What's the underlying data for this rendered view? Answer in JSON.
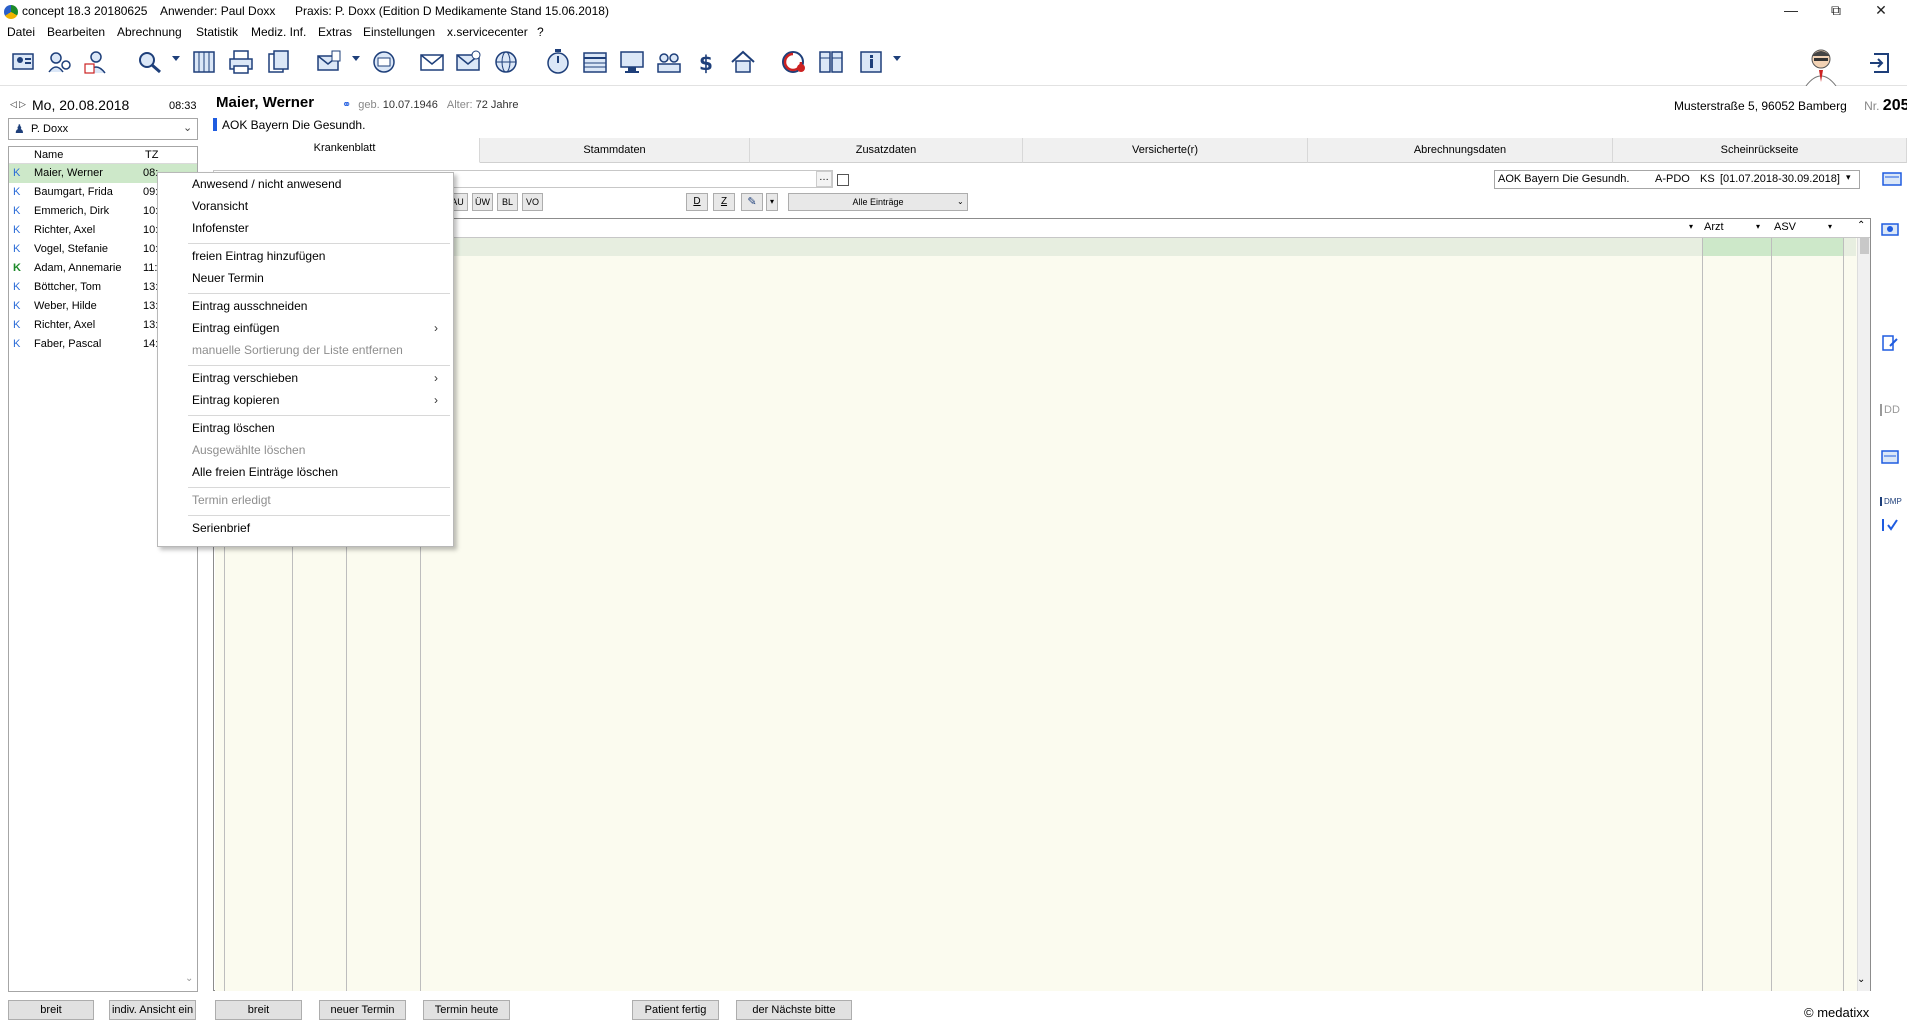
{
  "titlebar": {
    "app": "concept 18.3 20180625",
    "user": "Anwender:  Paul Doxx",
    "practice": "Praxis: P. Doxx  (Edition D Medikamente  Stand 15.06.2018)"
  },
  "menu": [
    "Datei",
    "Bearbeiten",
    "Abrechnung",
    "Statistik",
    "Mediz. Inf.",
    "Extras",
    "Einstellungen",
    "x.servicecenter",
    "?"
  ],
  "left": {
    "date": "Mo, 20.08.2018",
    "time": "08:33",
    "user": "P. Doxx",
    "columns": {
      "name": "Name",
      "tz": "TZ"
    },
    "patients": [
      {
        "k": "K",
        "name": "Maier, Werner",
        "tz": "08:"
      },
      {
        "k": "K",
        "name": "Baumgart, Frida",
        "tz": "09:"
      },
      {
        "k": "K",
        "name": "Emmerich, Dirk",
        "tz": "10:"
      },
      {
        "k": "K",
        "name": "Richter, Axel",
        "tz": "10:"
      },
      {
        "k": "K",
        "name": "Vogel, Stefanie",
        "tz": "10:"
      },
      {
        "k": "K",
        "name": "Adam, Annemarie",
        "tz": "11:"
      },
      {
        "k": "K",
        "name": "Böttcher, Tom",
        "tz": "13:"
      },
      {
        "k": "K",
        "name": "Weber, Hilde",
        "tz": "13:"
      },
      {
        "k": "K",
        "name": "Richter, Axel",
        "tz": "13:"
      },
      {
        "k": "K",
        "name": "Faber, Pascal",
        "tz": "14:"
      }
    ],
    "btn_breit": "breit",
    "btn_indiv": "indiv. Ansicht ein"
  },
  "patient": {
    "name": "Maier, Werner",
    "geb_label": "geb.",
    "geb": "10.07.1946",
    "alter_label": "Alter:",
    "alter": "72 Jahre",
    "address": "Musterstraße 5, 96052 Bamberg",
    "nr_label": "Nr.",
    "nr": "205",
    "insurance": "AOK Bayern Die Gesundh."
  },
  "tabs": [
    "Krankenblatt",
    "Stammdaten",
    "Zusatzdaten",
    "Versicherte(r)",
    "Abrechnungsdaten",
    "Scheinrückseite"
  ],
  "filter": {
    "toggles": [
      "AU",
      "ÜW",
      "BL",
      "VO"
    ],
    "d": "D",
    "z": "Z",
    "dropdown": "Alle Einträge",
    "schein": "AOK Bayern Die Gesundh.",
    "schein_type": "A-PDO",
    "schein_ks": "KS",
    "schein_period": "[01.07.2018-30.09.2018]"
  },
  "columns": {
    "arzt": "Arzt",
    "asv": "ASV"
  },
  "context_menu": {
    "items": [
      {
        "label": "Anwesend / nicht anwesend",
        "disabled": false
      },
      {
        "label": "Voransicht",
        "disabled": false
      },
      {
        "label": "Infofenster",
        "disabled": false
      },
      {
        "label": "freien Eintrag hinzufügen",
        "disabled": false
      },
      {
        "label": "Neuer Termin",
        "disabled": false
      },
      {
        "label": "Eintrag ausschneiden",
        "disabled": false
      },
      {
        "label": "Eintrag einfügen",
        "disabled": false,
        "submenu": true
      },
      {
        "label": "manuelle Sortierung der Liste entfernen",
        "disabled": true
      },
      {
        "label": "Eintrag verschieben",
        "disabled": false,
        "submenu": true
      },
      {
        "label": "Eintrag kopieren",
        "disabled": false,
        "submenu": true
      },
      {
        "label": "Eintrag löschen",
        "disabled": false
      },
      {
        "label": "Ausgewählte löschen",
        "disabled": true
      },
      {
        "label": "Alle freien Einträge löschen",
        "disabled": false
      },
      {
        "label": "Termin erledigt",
        "disabled": true
      },
      {
        "label": "Serienbrief",
        "disabled": false
      }
    ]
  },
  "bottom": {
    "breit": "breit",
    "neuer_termin": "neuer Termin",
    "termin_heute": "Termin heute",
    "patient_fertig": "Patient fertig",
    "naechste": "der Nächste bitte",
    "copyright": "© medatixx"
  },
  "right_labels": {
    "dd": "DD",
    "dmp": "DMP"
  },
  "colors": {
    "accent": "#1f5ce0",
    "selected_row": "#cde8c9",
    "entry_bg": "#fbfbef",
    "list_k": "#2b6cd8"
  }
}
